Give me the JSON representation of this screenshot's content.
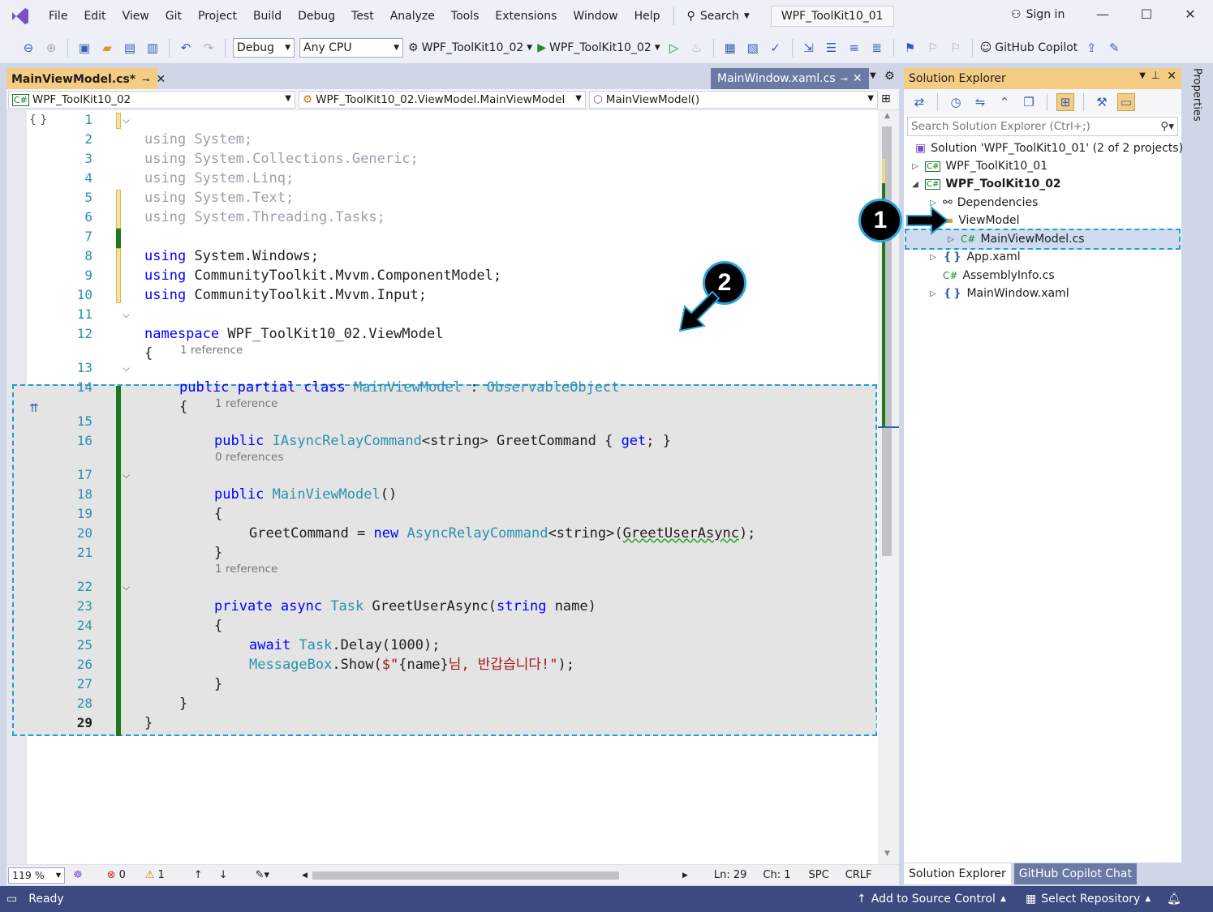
{
  "menu": {
    "items": [
      "File",
      "Edit",
      "View",
      "Git",
      "Project",
      "Build",
      "Debug",
      "Test",
      "Analyze",
      "Tools",
      "Extensions",
      "Window",
      "Help"
    ],
    "search_label": "Search",
    "title": "WPF_ToolKit10_01",
    "sign_in": "Sign in"
  },
  "toolbar": {
    "config": "Debug",
    "platform": "Any CPU",
    "startup_project": "WPF_ToolKit10_02",
    "run_target": "WPF_ToolKit10_02",
    "copilot": "GitHub Copilot"
  },
  "tabs": {
    "active": "MainViewModel.cs*",
    "inactive": "MainWindow.xaml.cs"
  },
  "navbar": {
    "project": "WPF_ToolKit10_02",
    "type": "WPF_ToolKit10_02.ViewModel.MainViewModel",
    "member": "MainViewModel()"
  },
  "code": {
    "line_numbers": [
      "1",
      "2",
      "3",
      "4",
      "5",
      "6",
      "7",
      "8",
      "9",
      "10",
      "11",
      "12",
      "13",
      "14",
      "15",
      "16",
      "17",
      "18",
      "19",
      "20",
      "21",
      "22",
      "23",
      "24",
      "25",
      "26",
      "27",
      "28",
      "29"
    ],
    "l1": "System;",
    "l2": "System.Collections.Generic;",
    "l3": "System.Linq;",
    "l4": "System.Text;",
    "l5": "System.Threading.Tasks;",
    "using_kw": "using",
    "l7": "System.Windows;",
    "l8": "CommunityToolkit.Mvvm.ComponentModel;",
    "l9": "CommunityToolkit.Mvvm.Input;",
    "ns_kw": "namespace",
    "l11": "WPF_ToolKit10_02.ViewModel",
    "open_brace": "{",
    "close_brace": "}",
    "lens13": "1 reference",
    "l13_kw": "public partial class",
    "l13_name": "MainViewModel",
    "l13_colon": " : ",
    "l13_base": "ObservableObject",
    "lens15": "1 reference",
    "l15_kw": "public",
    "l15_type": "IAsyncRelayCommand",
    "l15_generic": "<string>",
    "l15_name": " GreetCommand { ",
    "l15_get": "get",
    "l15_end": "; }",
    "lens17": "0 references",
    "l17_kw": "public",
    "l17_name": "MainViewModel",
    "l17_end": "()",
    "l19_a": "GreetCommand = ",
    "l19_new": "new",
    "l19_type": "AsyncRelayCommand",
    "l19_generic": "<string>",
    "l19_arg": "GreetUserAsync",
    "l19_end": ");",
    "lens22": "1 reference",
    "l22_kw": "private async",
    "l22_task": "Task",
    "l22_name": " GreetUserAsync(",
    "l22_string": "string",
    "l22_end": " name)",
    "l24_await": "await",
    "l24_task": "Task",
    "l24_rest": ".Delay(1000);",
    "l25_mb": "MessageBox",
    "l25_show": ".Show(",
    "l25_str1": "$\"",
    "l25_interp": "{name}",
    "l25_str2": "님, 반갑습니다!\"",
    "l25_end": ");"
  },
  "statusline": {
    "zoom": "119 %",
    "errors": "0",
    "warnings": "1",
    "line": "Ln: 29",
    "col": "Ch: 1",
    "spc": "SPC",
    "eol": "CRLF"
  },
  "solution_explorer": {
    "title": "Solution Explorer",
    "search_placeholder": "Search Solution Explorer (Ctrl+;)",
    "solution": "Solution 'WPF_ToolKit10_01' (2 of 2 projects)",
    "project1": "WPF_ToolKit10_01",
    "project2": "WPF_ToolKit10_02",
    "dependencies": "Dependencies",
    "viewmodel_folder": "ViewModel",
    "mainviewmodel_file": "MainViewModel.cs",
    "app_xaml": "App.xaml",
    "assemblyinfo": "AssemblyInfo.cs",
    "mainwindow": "MainWindow.xaml",
    "tab_se": "Solution Explorer",
    "tab_copilot": "GitHub Copilot Chat"
  },
  "properties_tab": "Properties",
  "status": {
    "ready": "Ready",
    "source_control": "Add to Source Control",
    "repository": "Select Repository"
  },
  "callouts": [
    "1",
    "2"
  ]
}
